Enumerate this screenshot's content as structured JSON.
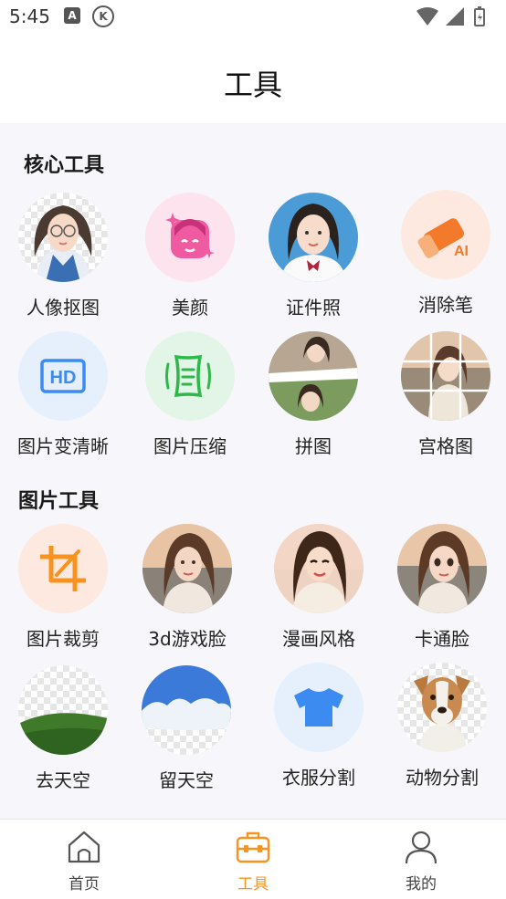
{
  "status": {
    "time": "5:45"
  },
  "header": {
    "title": "工具"
  },
  "sections": {
    "core": {
      "title": "核心工具"
    },
    "image": {
      "title": "图片工具"
    }
  },
  "tools": {
    "portrait_cutout": "人像抠图",
    "beauty": "美颜",
    "id_photo": "证件照",
    "eraser": "消除笔",
    "hd": "图片变清晰",
    "compress": "图片压缩",
    "collage": "拼图",
    "grid": "宫格图",
    "crop": "图片裁剪",
    "face_3d": "3d游戏脸",
    "comic": "漫画风格",
    "cartoon": "卡通脸",
    "remove_sky": "去天空",
    "keep_sky": "留天空",
    "clothes_seg": "衣服分割",
    "animal_seg": "动物分割"
  },
  "icons": {
    "hd_text": "HD",
    "ai_text": "AI"
  },
  "nav": {
    "home": "首页",
    "tools": "工具",
    "mine": "我的"
  },
  "colors": {
    "accent": "#f7931e",
    "blue": "#3b8bf0",
    "green": "#2fb84a",
    "pink": "#f05aa0"
  }
}
